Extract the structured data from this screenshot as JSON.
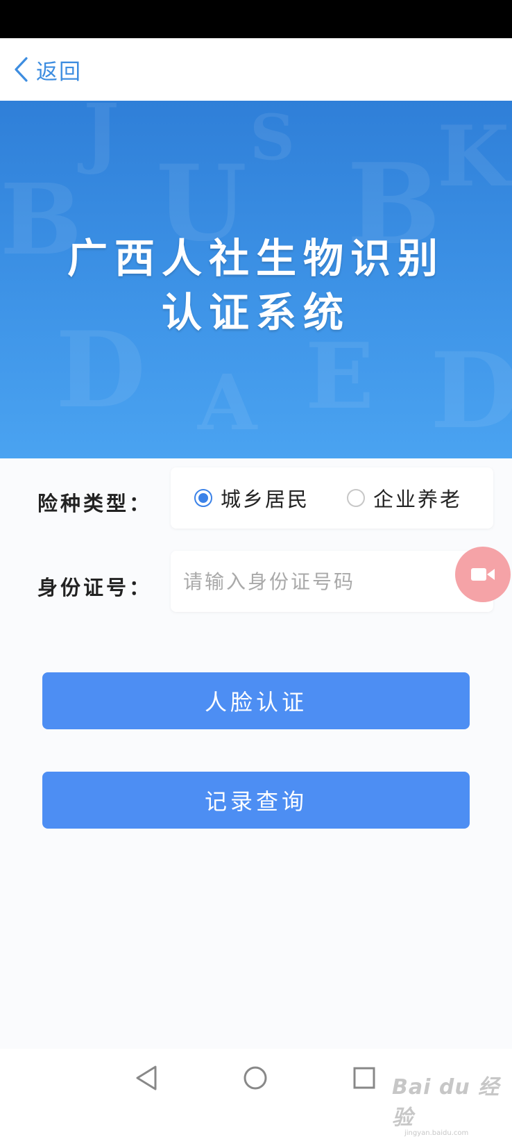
{
  "nav": {
    "back_label": "返回"
  },
  "banner": {
    "title_line1": "广西人社生物识别",
    "title_line2": "认证系统"
  },
  "form": {
    "insurance_type_label": "险种类型：",
    "options": [
      {
        "label": "城乡居民",
        "selected": true
      },
      {
        "label": "企业养老",
        "selected": false
      }
    ],
    "id_label": "身份证号：",
    "id_placeholder": "请输入身份证号码",
    "id_value": ""
  },
  "buttons": {
    "face_auth": "人脸认证",
    "record_query": "记录查询"
  },
  "floating": {
    "icon": "video-camera-icon",
    "color": "#f5a3a7"
  },
  "system_nav": {
    "icons": [
      "back-triangle-icon",
      "home-circle-icon",
      "recents-square-icon"
    ]
  },
  "watermark": {
    "main": "Bai du 经验",
    "sub": "jingyan.baidu.com"
  },
  "colors": {
    "primary": "#4d8ef3",
    "banner": "#3a8ce3",
    "back": "#3d8de0"
  }
}
